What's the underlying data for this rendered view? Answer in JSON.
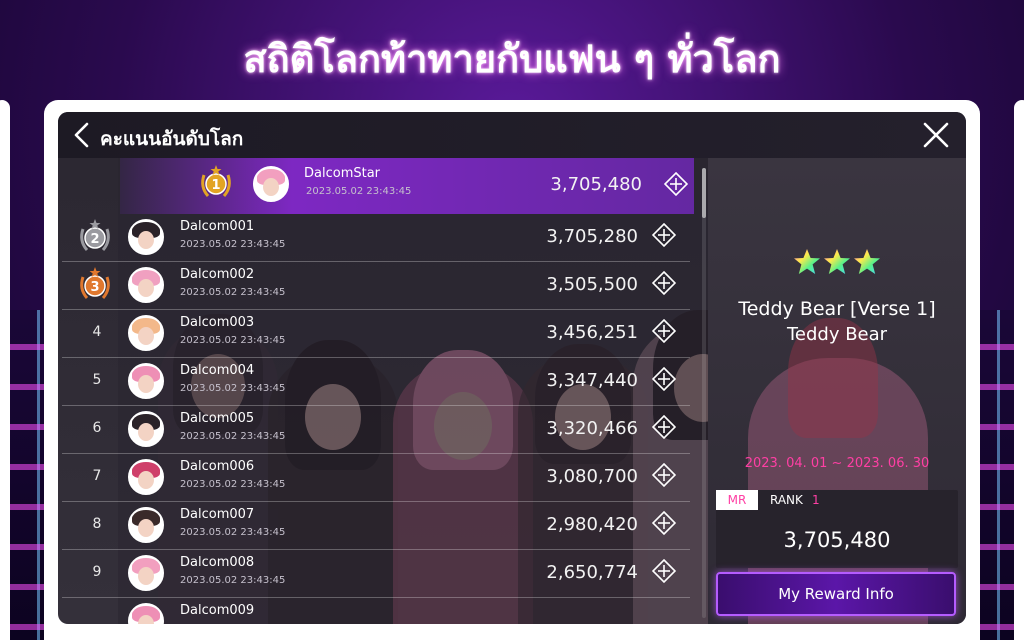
{
  "headline": "สถิติโลกท้าทายกับแฟน ๆ ทั่วโลก",
  "window": {
    "title": "คะแนนอันดับโลก"
  },
  "leaderboard": [
    {
      "rank": "1",
      "name": "DalcomStar",
      "date": "2023.05.02 23:43:45",
      "score": "3,705,480",
      "hair": "#f29fbf"
    },
    {
      "rank": "2",
      "name": "Dalcom001",
      "date": "2023.05.02 23:43:45",
      "score": "3,705,280",
      "hair": "#2a2228"
    },
    {
      "rank": "3",
      "name": "Dalcom002",
      "date": "2023.05.02 23:43:45",
      "score": "3,505,500",
      "hair": "#f0a0c0"
    },
    {
      "rank": "4",
      "name": "Dalcom003",
      "date": "2023.05.02 23:43:45",
      "score": "3,456,251",
      "hair": "#f3b88a"
    },
    {
      "rank": "5",
      "name": "Dalcom004",
      "date": "2023.05.02 23:43:45",
      "score": "3,347,440",
      "hair": "#ee8fb5"
    },
    {
      "rank": "6",
      "name": "Dalcom005",
      "date": "2023.05.02 23:43:45",
      "score": "3,320,466",
      "hair": "#2a2228"
    },
    {
      "rank": "7",
      "name": "Dalcom006",
      "date": "2023.05.02 23:43:45",
      "score": "3,080,700",
      "hair": "#cf3f6a"
    },
    {
      "rank": "8",
      "name": "Dalcom007",
      "date": "2023.05.02 23:43:45",
      "score": "2,980,420",
      "hair": "#3a2a2a"
    },
    {
      "rank": "9",
      "name": "Dalcom008",
      "date": "2023.05.02 23:43:45",
      "score": "2,650,774",
      "hair": "#f29fbf"
    },
    {
      "rank": "",
      "name": "Dalcom009",
      "date": "",
      "score": "",
      "hair": "#ee8fb5"
    }
  ],
  "song": {
    "star_count": 3,
    "title": "Teddy Bear [Verse 1]",
    "artist": "Teddy Bear",
    "period": "2023. 04. 01 ~ 2023. 06. 30"
  },
  "my_rank": {
    "mode": "MR",
    "rank_label": "RANK",
    "rank": "1",
    "score": "3,705,480"
  },
  "reward_button": "My Reward Info",
  "colors": {
    "accent_pink": "#ff3fa4",
    "accent_purple": "#8c28dc",
    "gold": "#e2a424",
    "silver": "#9a9aa0",
    "bronze": "#e0782e"
  }
}
